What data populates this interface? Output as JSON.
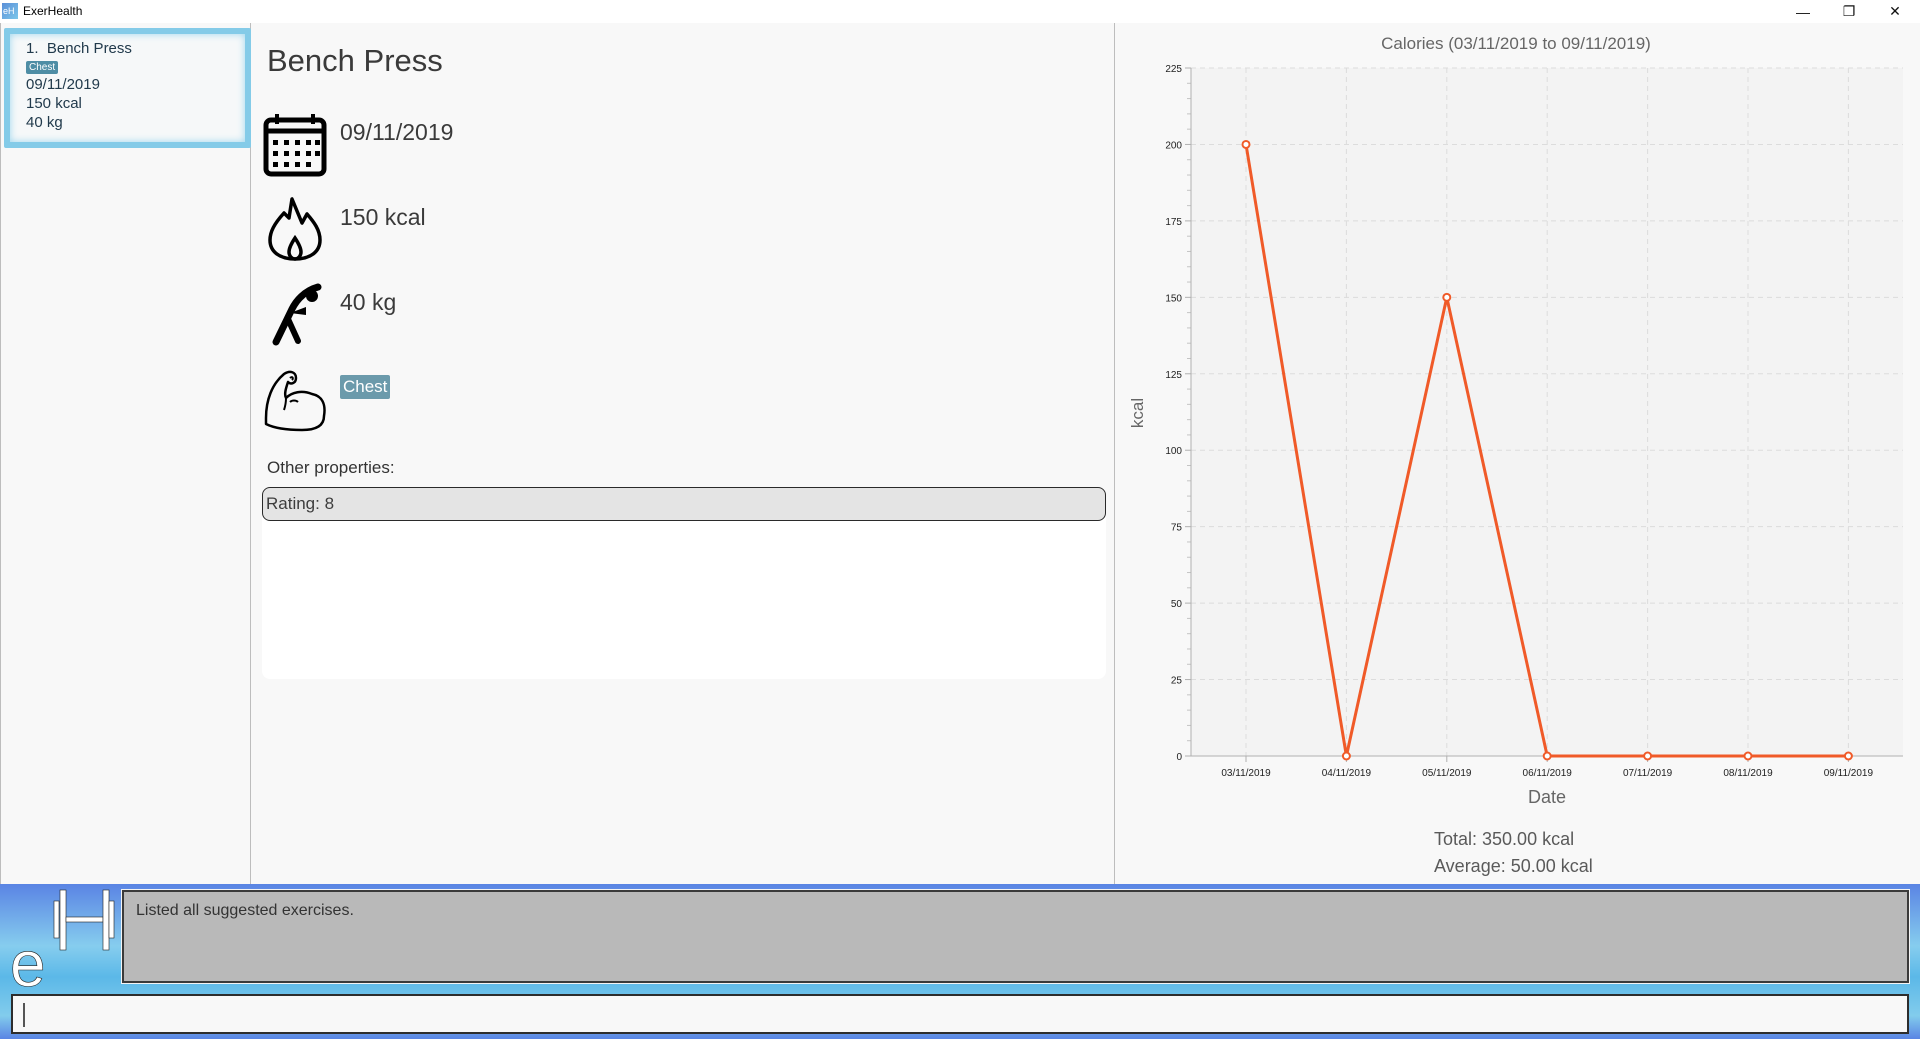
{
  "window": {
    "title": "ExerHealth",
    "app_icon": "eH",
    "controls": {
      "minimize": "—",
      "maximize": "❐",
      "close": "✕"
    }
  },
  "exercise_list": {
    "items": [
      {
        "index": "1.",
        "name": "Bench Press",
        "muscle_tag": "Chest",
        "date": "09/11/2019",
        "calories": "150 kcal",
        "quantity": "40 kg"
      }
    ]
  },
  "detail": {
    "name": "Bench Press",
    "date": "09/11/2019",
    "calories": "150 kcal",
    "quantity": "40 kg",
    "muscle": "Chest",
    "other_properties_label": "Other properties:",
    "other_properties": [
      "Rating: 8"
    ]
  },
  "stats": {
    "total": "Total: 350.00 kcal",
    "average": "Average: 50.00 kcal"
  },
  "chart_data": {
    "type": "line",
    "title": "Calories (03/11/2019 to 09/11/2019)",
    "xlabel": "Date",
    "ylabel": "kcal",
    "categories": [
      "03/11/2019",
      "04/11/2019",
      "05/11/2019",
      "06/11/2019",
      "07/11/2019",
      "08/11/2019",
      "09/11/2019"
    ],
    "series": [
      {
        "name": "Calories",
        "values": [
          200,
          0,
          150,
          0,
          0,
          0,
          0
        ],
        "color": "#f05a28"
      }
    ],
    "ylim": [
      0,
      225
    ],
    "yticks": [
      0,
      25,
      50,
      75,
      100,
      125,
      150,
      175,
      200,
      225
    ],
    "minor_tick_step": 5,
    "grid": true,
    "legend": "none"
  },
  "command": {
    "result": "Listed all suggested exercises.",
    "input_value": "",
    "input_placeholder": ""
  }
}
